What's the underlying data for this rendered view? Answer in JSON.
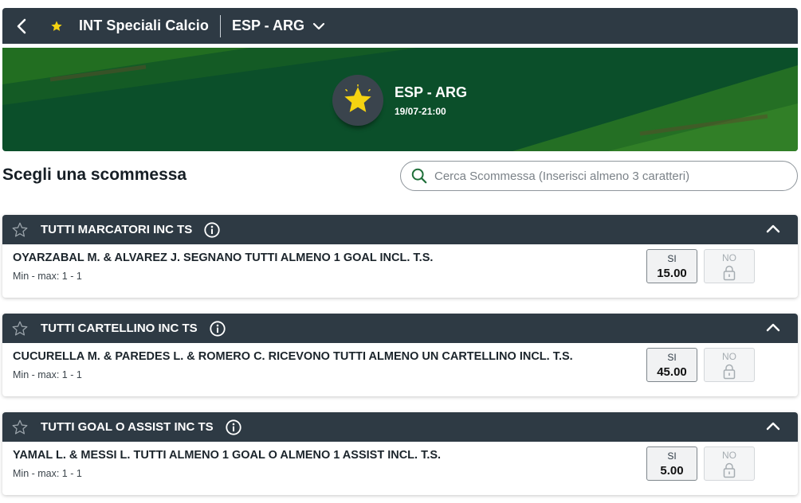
{
  "topbar": {
    "back_icon": "chevron-left-icon",
    "star_icon": "star-icon",
    "competition": "INT Speciali Calcio",
    "event": "ESP - ARG",
    "dropdown_icon": "chevron-down-icon"
  },
  "banner": {
    "emblem_icon": "star-icon",
    "event_name": "ESP - ARG",
    "datetime": "19/07-21:00",
    "colors": {
      "background": "#0b4f2a",
      "stripe": "#2f7d22",
      "star": "#f5d311"
    }
  },
  "heading": "Scegli una scommessa",
  "search": {
    "icon": "search-icon",
    "placeholder": "Cerca Scommessa (Inserisci almeno 3 caratteri)"
  },
  "markets": [
    {
      "title": "TUTTI MARCATORI INC TS",
      "selection": "OYARZABAL M. & ALVAREZ J. SEGNANO TUTTI ALMENO 1 GOAL INCL. T.S.",
      "minmax": "Min - max: 1 - 1",
      "si_label": "SI",
      "si_value": "15.00",
      "no_label": "NO",
      "no_state": "locked"
    },
    {
      "title": "TUTTI CARTELLINO INC TS",
      "selection": "CUCURELLA M. & PAREDES L. & ROMERO C. RICEVONO TUTTI ALMENO UN CARTELLINO INCL. T.S.",
      "minmax": "Min - max: 1 - 1",
      "si_label": "SI",
      "si_value": "45.00",
      "no_label": "NO",
      "no_state": "locked"
    },
    {
      "title": "TUTTI GOAL O ASSIST INC TS",
      "selection": "YAMAL L. & MESSI L. TUTTI ALMENO 1 GOAL O ALMENO 1 ASSIST INCL. T.S.",
      "minmax": "Min - max: 1 - 1",
      "si_label": "SI",
      "si_value": "5.00",
      "no_label": "NO",
      "no_state": "locked"
    }
  ],
  "colors": {
    "header": "#2e3a44",
    "search_icon": "#1f6f3a"
  }
}
